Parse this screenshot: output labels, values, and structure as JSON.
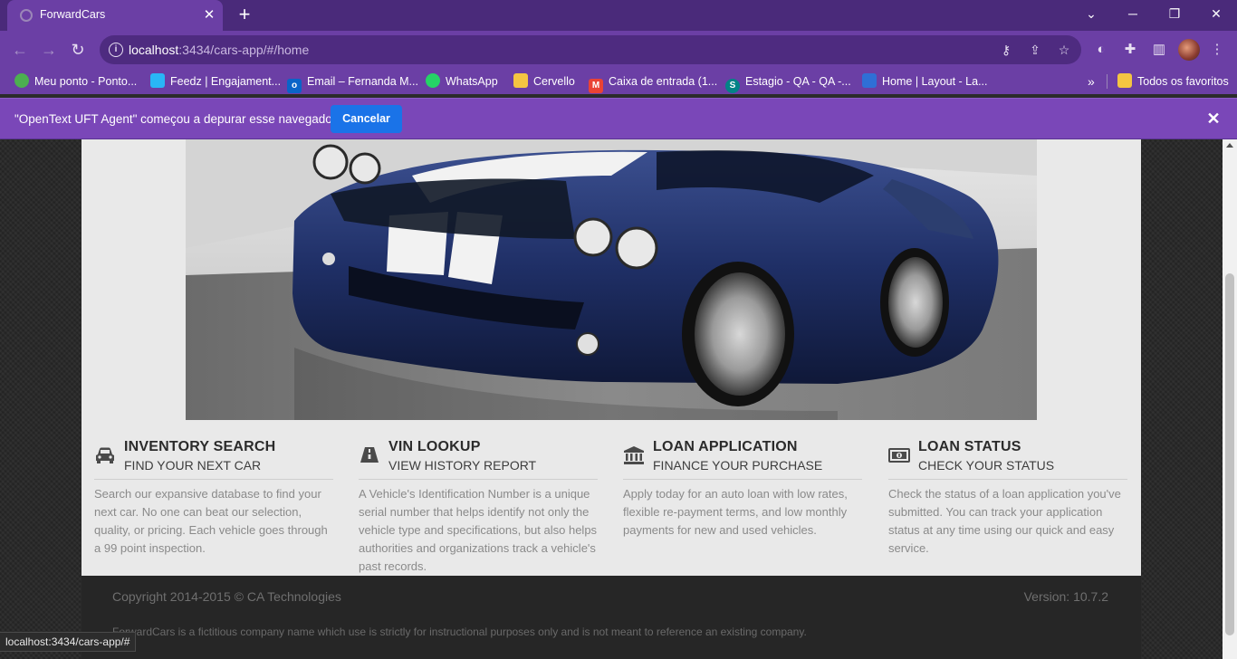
{
  "browser": {
    "tab_title": "ForwardCars",
    "url_host": "localhost",
    "url_rest": ":3434/cars-app/#/home",
    "bookmarks": [
      {
        "label": "Meu ponto - Ponto...",
        "icon": "ponto-icon",
        "color": "#4caf50"
      },
      {
        "label": "Feedz | Engajament...",
        "icon": "feedz-icon",
        "color": "#29b6f6"
      },
      {
        "label": "Email – Fernanda M...",
        "icon": "outlook-icon",
        "color": "#0a64c8"
      },
      {
        "label": "WhatsApp",
        "icon": "whatsapp-icon",
        "color": "#25d366"
      },
      {
        "label": "Cervello",
        "icon": "folder-icon",
        "color": "#f4c542"
      },
      {
        "label": "Caixa de entrada (1...",
        "icon": "gmail-icon",
        "color": "#ea4335"
      },
      {
        "label": "Estagio - QA - QA -...",
        "icon": "sharepoint-icon",
        "color": "#038387"
      },
      {
        "label": "Home | Layout - La...",
        "icon": "layout-icon",
        "color": "#2f6fd6"
      }
    ],
    "all_bookmarks_label": "Todos os favoritos",
    "infobar_text": "\"OpenText UFT Agent\" começou a depurar esse navegador",
    "infobar_button": "Cancelar",
    "status_url": "localhost:3434/cars-app/#"
  },
  "features": [
    {
      "title": "INVENTORY SEARCH",
      "subtitle": "FIND YOUR NEXT CAR",
      "description": "Search our expansive database to find your next car. No one can beat our selection, quality, or pricing. Each vehicle goes through a 99 point inspection.",
      "icon": "car-icon"
    },
    {
      "title": "VIN LOOKUP",
      "subtitle": "VIEW HISTORY REPORT",
      "description": "A Vehicle's Identification Number is a unique serial number that helps identify not only the vehicle type and specifications, but also helps authorities and organizations track a vehicle's past records.",
      "icon": "road-icon"
    },
    {
      "title": "LOAN APPLICATION",
      "subtitle": "FINANCE YOUR PURCHASE",
      "description": "Apply today for an auto loan with low rates, flexible re-payment terms, and low monthly payments for new and used vehicles.",
      "icon": "bank-icon"
    },
    {
      "title": "LOAN STATUS",
      "subtitle": "CHECK YOUR STATUS",
      "description": "Check the status of a loan application you've submitted. You can track your application status at any time using our quick and easy service.",
      "icon": "money-icon"
    }
  ],
  "footer": {
    "copyright": "Copyright 2014-2015 © CA Technologies",
    "version": "Version: 10.7.2",
    "disclaimer": "ForwardCars is a fictitious company name which use is strictly for instructional purposes only and is not meant to reference an existing company."
  }
}
